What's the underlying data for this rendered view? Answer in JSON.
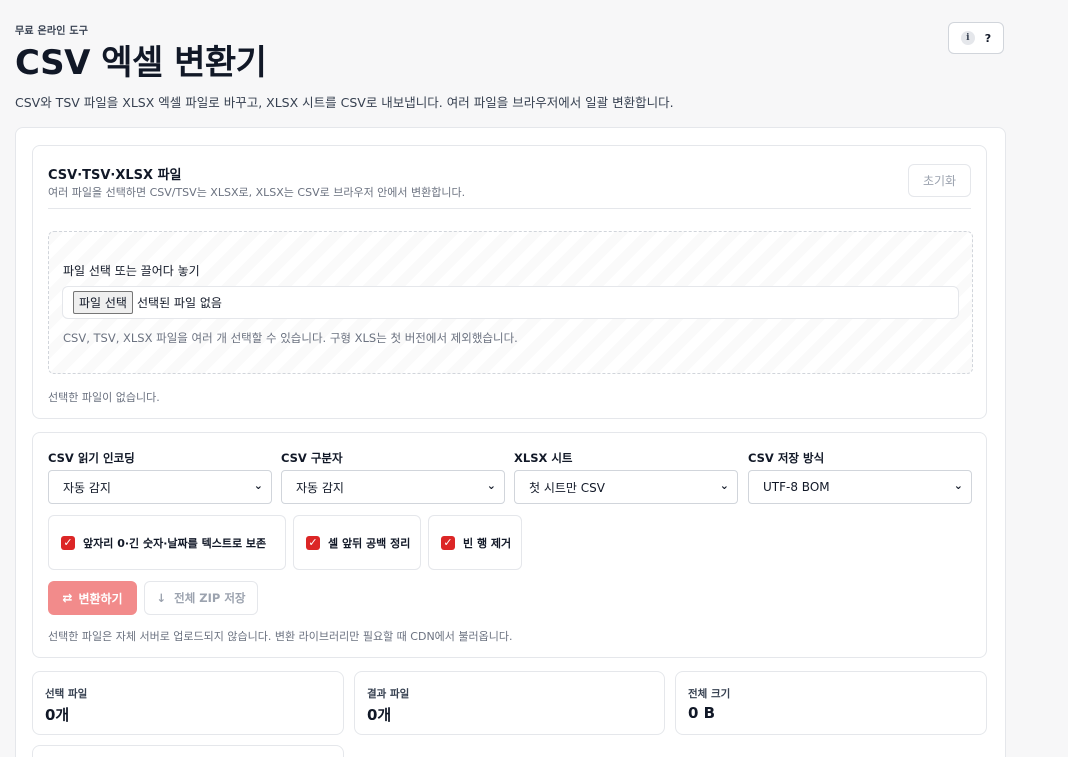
{
  "header": {
    "eyebrow": "무료 온라인 도구",
    "title": "CSV 엑셀 변환기",
    "subtitle": "CSV와 TSV 파일을 XLSX 엑셀 파일로 바꾸고, XLSX 시트를 CSV로 내보냅니다. 여러 파일을 브라우저에서 일괄 변환합니다.",
    "info_icon": "i",
    "help_icon": "?"
  },
  "file_panel": {
    "title": "CSV·TSV·XLSX 파일",
    "description": "여러 파일을 선택하면 CSV/TSV는 XLSX로, XLSX는 CSV로 브라우저 안에서 변환합니다.",
    "reset_label": "초기화",
    "drop_label": "파일 선택 또는 끌어다 놓기",
    "choose_button": "파일 선택",
    "no_file_text": "선택된 파일 없음",
    "hint": "CSV, TSV, XLSX 파일을 여러 개 선택할 수 있습니다. 구형 XLS는 첫 버전에서 제외했습니다.",
    "status": "선택한 파일이 없습니다."
  },
  "options": {
    "encoding": {
      "label": "CSV 읽기 인코딩",
      "value": "자동 감지"
    },
    "delimiter": {
      "label": "CSV 구분자",
      "value": "자동 감지"
    },
    "sheet": {
      "label": "XLSX 시트",
      "value": "첫 시트만 CSV"
    },
    "save_mode": {
      "label": "CSV 저장 방식",
      "value": "UTF-8 BOM"
    },
    "checkboxes": [
      {
        "label": "앞자리 0·긴 숫자·날짜를 텍스트로 보존",
        "checked": true
      },
      {
        "label": "셀 앞뒤 공백 정리",
        "checked": true
      },
      {
        "label": "빈 행 제거",
        "checked": true
      }
    ],
    "convert_label": "변환하기",
    "zip_label": "전체 ZIP 저장",
    "note": "선택한 파일은 자체 서버로 업로드되지 않습니다. 변환 라이브러리만 필요할 때 CDN에서 불러옵니다."
  },
  "stats": [
    {
      "label": "선택 파일",
      "value": "0개"
    },
    {
      "label": "결과 파일",
      "value": "0개"
    },
    {
      "label": "전체 크기",
      "value": "0 B"
    }
  ],
  "colors": {
    "accent": "#dc2626",
    "accent_disabled": "#f28b8b"
  }
}
